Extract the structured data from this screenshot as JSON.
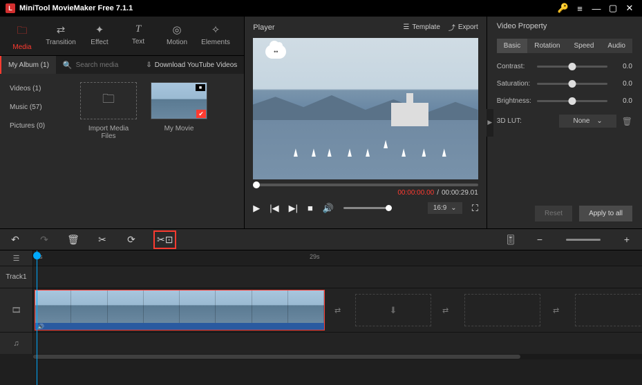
{
  "titlebar": {
    "logo": "L",
    "title": "MiniTool MovieMaker Free 7.1.1"
  },
  "toolTabs": [
    {
      "icon": "🗀",
      "label": "Media",
      "active": true
    },
    {
      "icon": "⇄",
      "label": "Transition"
    },
    {
      "icon": "✦",
      "label": "Effect"
    },
    {
      "icon": "T",
      "label": "Text"
    },
    {
      "icon": "◎",
      "label": "Motion"
    },
    {
      "icon": "✧",
      "label": "Elements"
    }
  ],
  "albumBar": {
    "myAlbum": "My Album (1)",
    "searchPlaceholder": "Search media",
    "ytLink": "Download YouTube Videos"
  },
  "library": {
    "cats": [
      "Videos (1)",
      "Music (57)",
      "Pictures (0)"
    ],
    "importLabel": "Import Media Files",
    "movieLabel": "My Movie"
  },
  "player": {
    "title": "Player",
    "template": "Template",
    "export": "Export",
    "currentTime": "00:00:00.00",
    "sep": "/",
    "totalTime": "00:00:29.01",
    "aspect": "16:9"
  },
  "videoProperty": {
    "title": "Video Property",
    "tabs": [
      "Basic",
      "Rotation",
      "Speed",
      "Audio"
    ],
    "rows": [
      {
        "label": "Contrast:",
        "value": "0.0"
      },
      {
        "label": "Saturation:",
        "value": "0.0"
      },
      {
        "label": "Brightness:",
        "value": "0.0"
      }
    ],
    "lutLabel": "3D LUT:",
    "lutValue": "None",
    "reset": "Reset",
    "applyAll": "Apply to all"
  },
  "tlTooltip": "Crop",
  "timeline": {
    "tick0": "0s",
    "tick29": "29s",
    "track1": "Track1"
  }
}
